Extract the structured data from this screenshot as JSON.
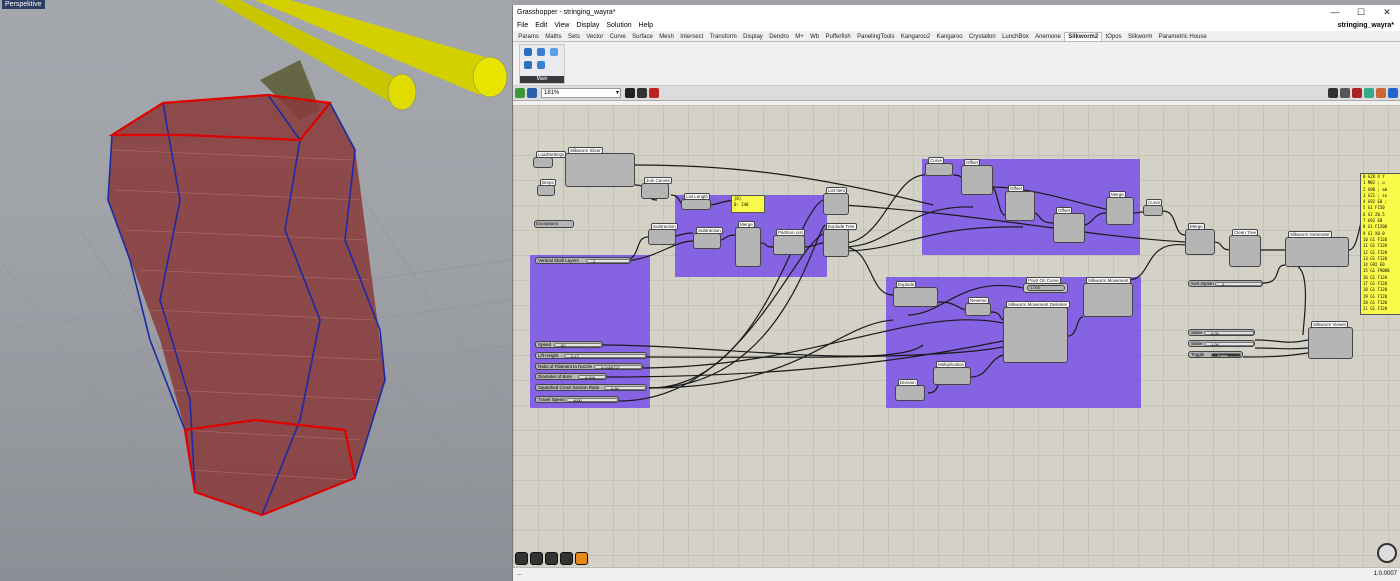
{
  "viewport": {
    "label": "Perspektive"
  },
  "window": {
    "title": "Grasshopper - stringing_wayra*",
    "doc_name": "stringing_wayra*",
    "min": "—",
    "max": "☐",
    "close": "✕"
  },
  "menu": [
    "File",
    "Edit",
    "View",
    "Display",
    "Solution",
    "Help"
  ],
  "tabs": [
    "Params",
    "Maths",
    "Sets",
    "Vector",
    "Curve",
    "Surface",
    "Mesh",
    "Intersect",
    "Transform",
    "Display",
    "Dendro",
    "M+",
    "Wb",
    "Pufferfish",
    "PanelingTools",
    "Kangaroo2",
    "Kangaroo",
    "Crystallon",
    "LunchBox",
    "Anemone",
    "Silkworm2",
    "tOpos",
    "Silkworm",
    "Parametric House"
  ],
  "active_tab": "Silkworm2",
  "ribbon": {
    "caption": "Main"
  },
  "zoom": "181%",
  "status": {
    "left": "...",
    "version": "1.0.0007"
  },
  "components": {
    "load_settings": "LoadSettings",
    "silkworm_slicer": "Silkworm Slicer",
    "breps": "Breps",
    "join_curves": "Join Curves",
    "list_length": "List Length",
    "list_item": "List Item",
    "explode_tree": "Explode Tree",
    "subtraction_1": "Subtraction",
    "subtraction_2": "Subtraction",
    "merge_1": "Merge",
    "partition_list": "Partition List",
    "curve_1": "Curve",
    "offset_1": "Offset",
    "offset_2": "Offset",
    "offset_3": "Offset",
    "merge_2": "Merge",
    "curve_2": "Curve",
    "merge_3": "Merge",
    "clean_tree": "Clean Tree",
    "silkworm_generator": "Silkworm Generator",
    "explode": "Explode",
    "point_on_curve": "Point On Curve",
    "silkworm_movement": "Silkworm Movement",
    "reverse": "Reverse",
    "movement_delimiter": "Silkworm Movement Delimiter",
    "multiplication": "Multiplication",
    "division": "Division",
    "silkworm_viewer": "Silkworm Viewer",
    "exceptions": "Exceptions"
  },
  "panel_value": "0: 240",
  "panel_count": "{0}",
  "sliders": [
    {
      "label": "Vertical Shell Layers",
      "value": "2"
    },
    {
      "label": "Speed",
      "value": "50"
    },
    {
      "label": "Lift Height",
      "value": "0.17"
    },
    {
      "label": "Ratio of Filament to Nozzle",
      "value": "0.0458727"
    },
    {
      "label": "Diameter of Bore",
      "value": "6.000"
    },
    {
      "label": "Squashed Cross Section Ratio",
      "value": "0.50"
    },
    {
      "label": "Travel Speed",
      "value": "4000"
    },
    {
      "label": "Sort Option",
      "value": "2"
    },
    {
      "label": "Slider",
      "value": "0.00"
    },
    {
      "label": "Slider",
      "value": "1.00"
    },
    {
      "label": "Toggle",
      "value": "False"
    }
  ],
  "point_slider": "1.000",
  "gcode_lines": [
    "0 G28 X Y",
    "1 M82 ; u",
    "2 G90 ; ab",
    "3 G21 ; se",
    "4 G92 E0 ;",
    "5 G1 F150",
    "6 G1 Z0.5",
    "7 G92 E0",
    "8 G1 F1200",
    "9 G1 X0.0",
    "10 G1 F120",
    "11 G1 F120",
    "12 G1 F120",
    "13 G1 F120",
    "14 G92 E0",
    "15 G1 F9000",
    "16 G1 F120",
    "17 G1 F120",
    "18 G1 F120",
    "19 G1 F120",
    "20 G1 F120",
    "21 G1 F120"
  ],
  "colors": {
    "canvas": "#d4d2c7",
    "group": "#7850e6",
    "panel": "#fafa4a",
    "wire": "#1a1a1a",
    "vase_edge": "#e00000",
    "vase_fill": "#8a3a3a",
    "rods": "#d4d000"
  }
}
